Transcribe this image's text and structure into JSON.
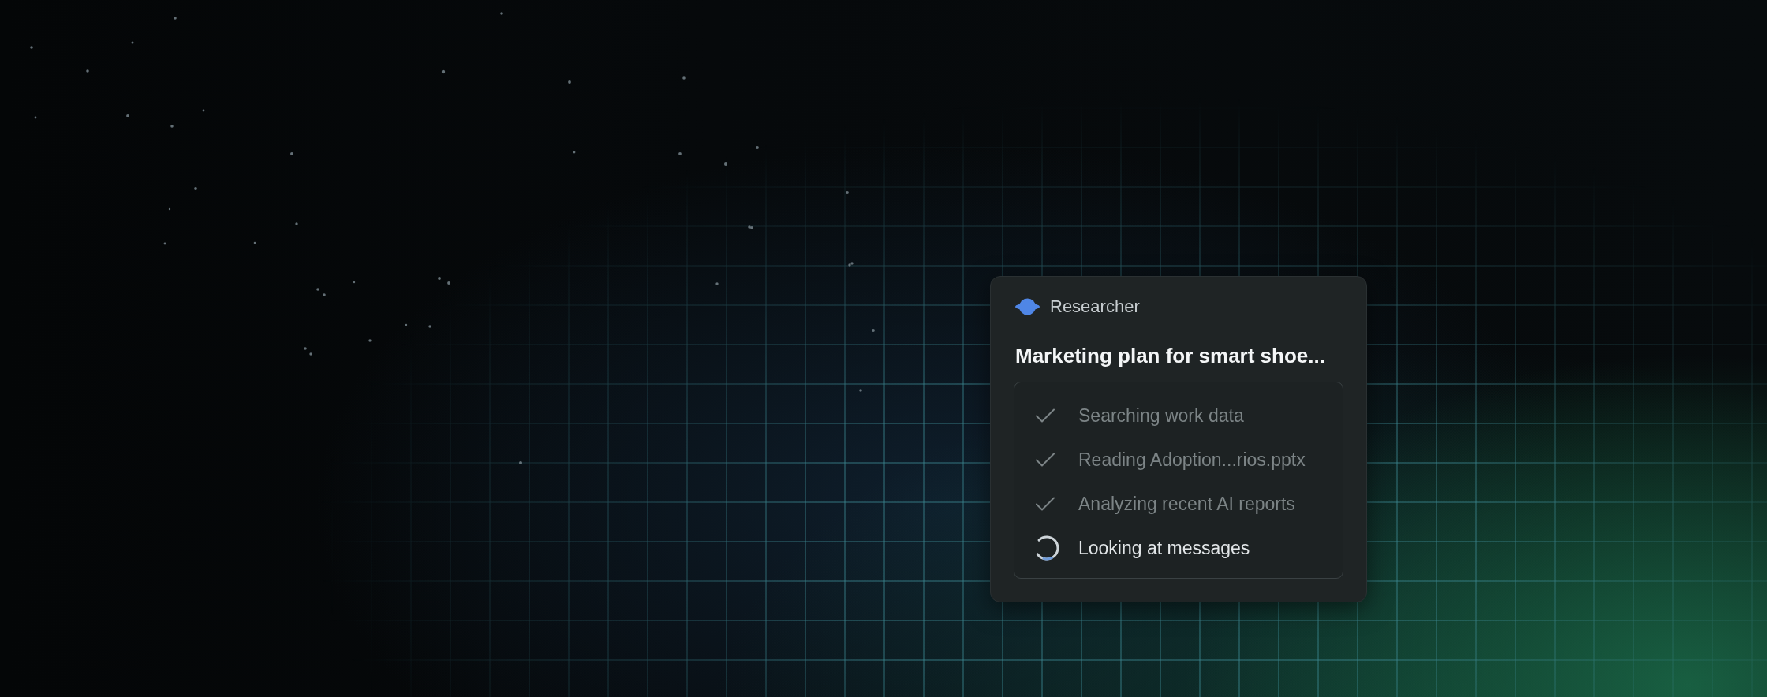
{
  "card": {
    "agent": {
      "name": "Researcher"
    },
    "title": "Marketing plan for smart shoe...",
    "steps": [
      {
        "label": "Searching work data",
        "kind": "done"
      },
      {
        "label": "Reading Adoption...rios.pptx",
        "kind": "done"
      },
      {
        "label": "Analyzing recent AI reports",
        "kind": "done"
      },
      {
        "label": "Looking at messages",
        "kind": "loading"
      }
    ]
  }
}
